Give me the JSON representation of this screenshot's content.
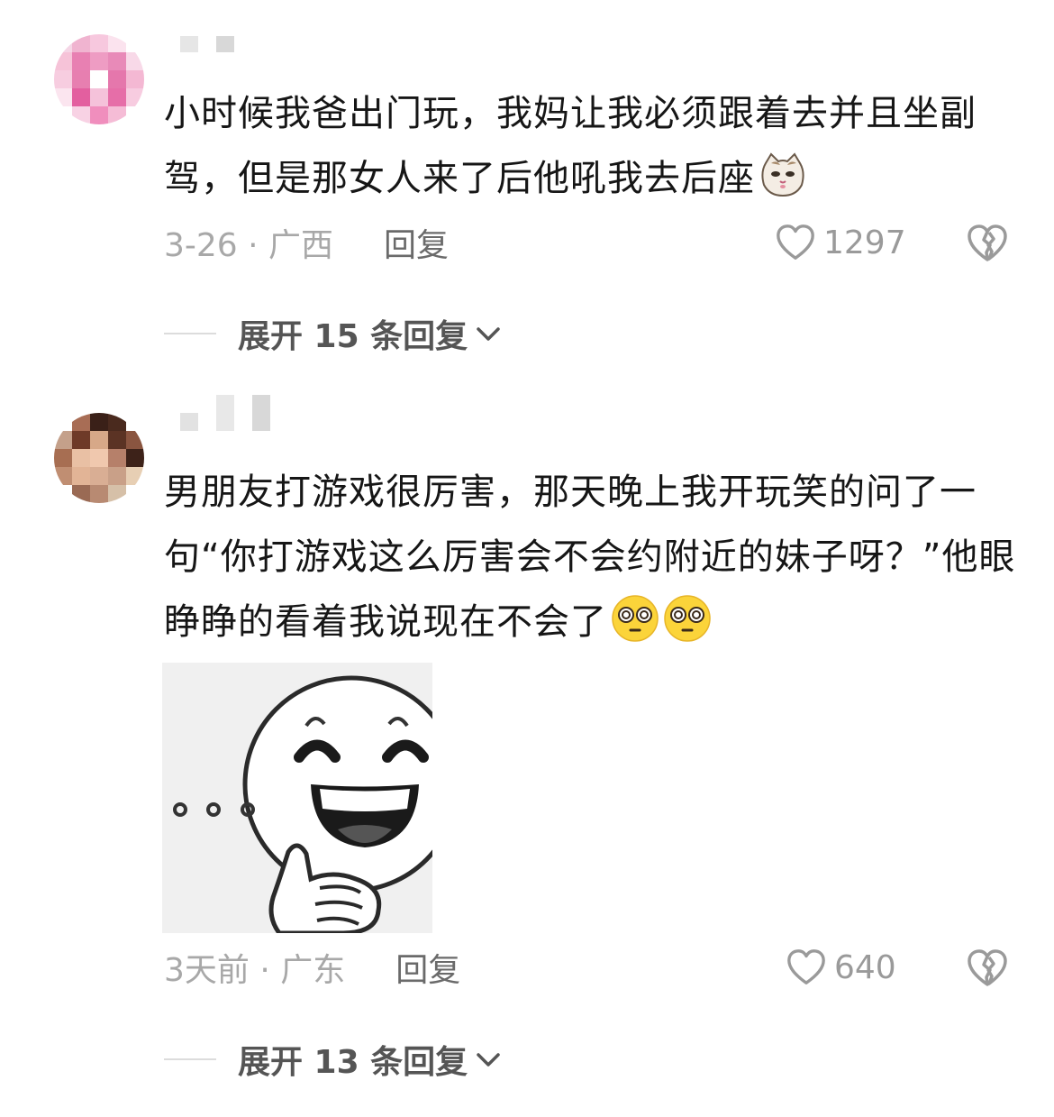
{
  "comments": [
    {
      "text": "小时候我爸出门玩，我妈让我必须跟着去并且坐副驾，但是那女人来了后他吼我去后座",
      "emoji": "cat-face-emoji",
      "meta": "3-26 · 广西",
      "reply_label": "回复",
      "likes": "1297",
      "expand_label": "展开 15 条回复"
    },
    {
      "text": "男朋友打游戏很厉害，那天晚上我开玩笑的问了一句“你打游戏这么厉害会不会约附近的妹子呀？”他眼睁睁的看着我说现在不会了",
      "emoji": "dizzy-face-emoji",
      "meta": "3天前 · 广东",
      "reply_label": "回复",
      "likes": "640",
      "expand_label": "展开 13 条回复"
    }
  ],
  "colors": {
    "text": "#161616",
    "meta": "#a8a8a8",
    "reply": "#6a6a6a",
    "expand": "#555555"
  }
}
